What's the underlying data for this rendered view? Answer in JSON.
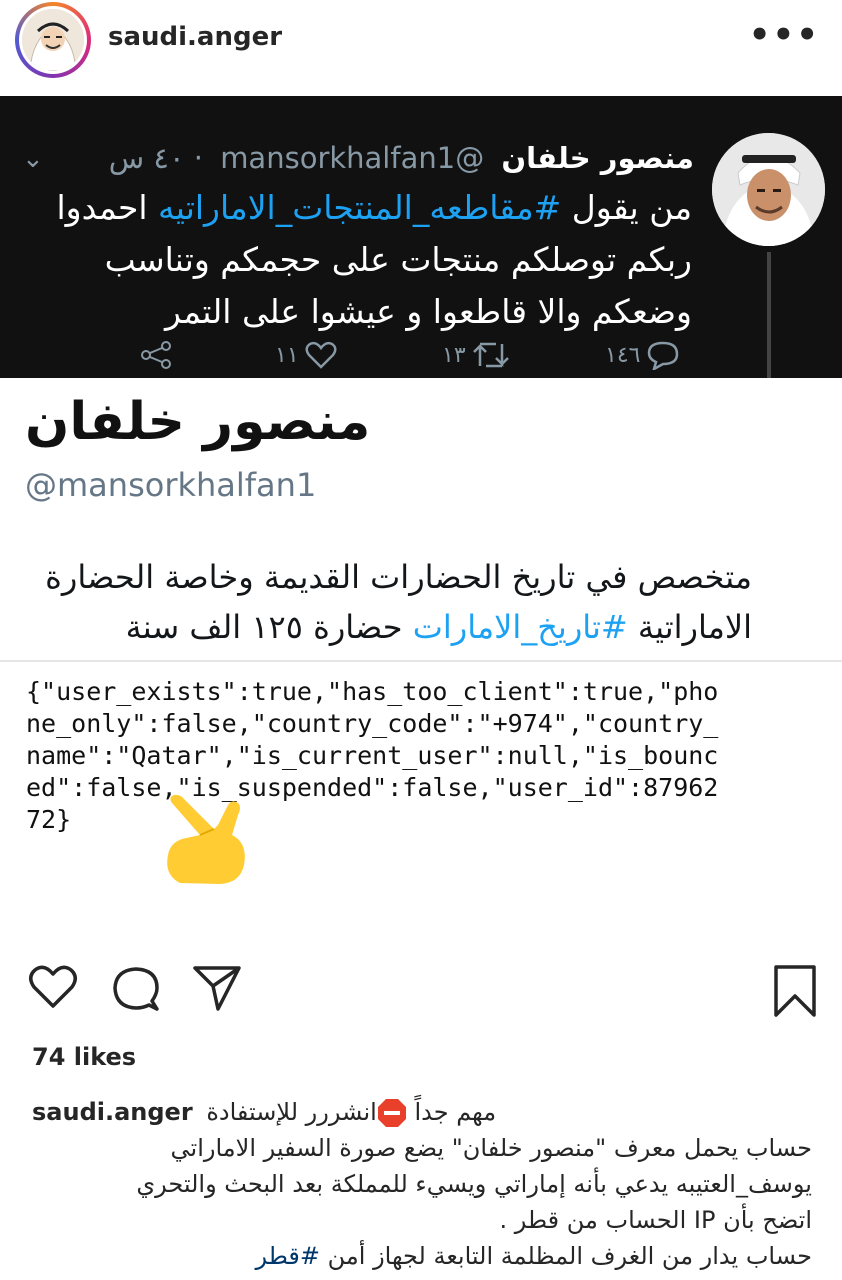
{
  "post": {
    "username": "saudi.anger",
    "more_label": "•••"
  },
  "tweet": {
    "name": "منصور خلفان",
    "handle": "@mansorkhalfan1",
    "time": "٤٠ س",
    "text_before": "من يقول ",
    "hashtag": "#مقاطعه_المنتجات_الاماراتيه",
    "text_after": " احمدوا ربكم توصلكم منتجات على حجمكم وتناسب وضعكم والا قاطعوا و عيشوا على التمر",
    "replies": "١٤٦",
    "retweets": "١٣",
    "likes": "١١"
  },
  "profile": {
    "name": "منصور خلفان",
    "handle": "@mansorkhalfan1",
    "bio_line1": "متخصص في تاريخ الحضارات القديمة وخاصة الحضارة",
    "bio_prefix": "الاماراتية ",
    "bio_hashtag": "#تاريخ_الامارات",
    "bio_suffix": " حضارة ١٢٥ الف سنة"
  },
  "json_text": "{\"user_exists\":true,\"has_too_client\":true,\"pho\nne_only\":false,\"country_code\":\"+974\",\"country_\nname\":\"Qatar\",\"is_current_user\":null,\"is_bounc\ned\":false,\"is_suspended\":false,\"user_id\":87962\n72}",
  "icons": {
    "like": "heart-icon",
    "comment": "comment-icon",
    "share": "send-icon",
    "save": "bookmark-icon",
    "pointer": "pointing-hand-emoji",
    "stop": "stop-sign-emoji"
  },
  "engagement": {
    "likes_label": "74 likes"
  },
  "caption": {
    "username": "saudi.anger",
    "line1_a": "مهم جداً ",
    "line1_b": "انشررر للإستفادة",
    "line2": "حساب يحمل معرف \"منصور خلفان\" يضع صورة السفير الاماراتي",
    "line3": "يوسف_العتيبه يدعي بأنه إماراتي ويسيء للمملكة بعد البحث والتحري",
    "line4": "اتضح بأن IP الحساب من قطر .",
    "line5_text": "حساب يدار من الغرف المظلمة التابعة لجهاز أمن ",
    "line5_tag": "#قطر"
  },
  "colors": {
    "tweet_bg": "#111111",
    "twitter_blue": "#1da1f2",
    "muted": "#8899a6"
  }
}
